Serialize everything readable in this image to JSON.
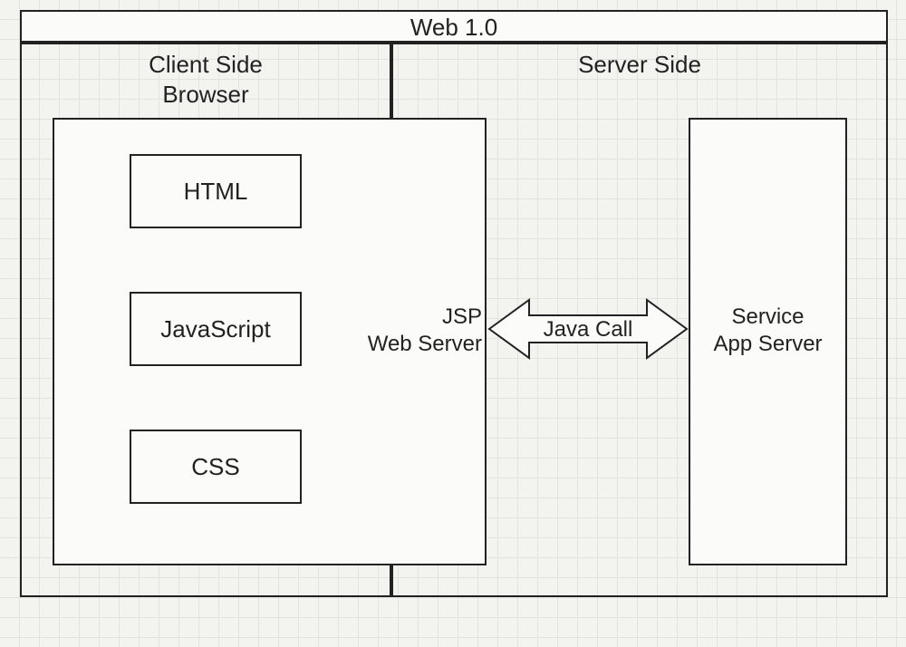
{
  "title": "Web 1.0",
  "left": {
    "heading": "Client Side\nBrowser",
    "techBox": {
      "items": [
        "HTML",
        "JavaScript",
        "CSS"
      ],
      "caption": "JSP\nWeb Server"
    }
  },
  "right": {
    "heading": "Server Side",
    "serviceBox": "Service\nApp Server"
  },
  "arrow": "Java Call"
}
